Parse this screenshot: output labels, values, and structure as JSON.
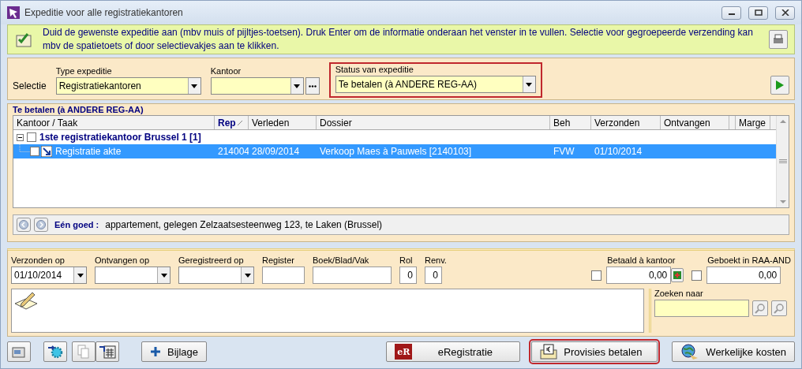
{
  "window": {
    "title": "Expeditie voor alle registratiekantoren"
  },
  "info": {
    "text": "Duid de gewenste expeditie aan (mbv muis of pijltjes-toetsen). Druk Enter om de informatie onderaan het venster in te vullen. Selectie voor gegroepeerde verzending kan mbv de spatietoets of door selectievakjes aan te klikken."
  },
  "selection": {
    "label": "Selectie",
    "fields": [
      {
        "label": "Type expeditie",
        "value": "Registratiekantoren",
        "kind": "dropdown",
        "highlighted": false
      },
      {
        "label": "Kantoor",
        "kind": "browse",
        "highlighted": false
      },
      {
        "label": "Status van expeditie",
        "value": "Te betalen (à ANDERE REG-AA)",
        "kind": "dropdown",
        "highlighted": true
      }
    ]
  },
  "group": {
    "title": "Te betalen (à ANDERE REG-AA)"
  },
  "table": {
    "columns": [
      "Kantoor / Taak",
      "Rep",
      "Verleden",
      "Dossier",
      "Beh",
      "Verzonden",
      "Ontvangen",
      "Marge"
    ],
    "rows": [
      {
        "label": "1ste registratiekantoor Brussel 1 [1]",
        "expanded": true,
        "checked": false,
        "children": [
          {
            "cells": [
              "Registratie akte",
              "214004",
              "28/09/2014",
              "Verkoop Maes à Pauwels [2140103]",
              "FVW",
              "01/10/2014"
            ],
            "checked": false,
            "selected": true
          }
        ]
      }
    ]
  },
  "goed": {
    "label": "Eén goed :",
    "text": "appartement, gelegen Zelzaatsesteenweg 123, te Laken (Brussel)"
  },
  "details": {
    "fields": [
      {
        "label": "Verzonden op",
        "value": "01/10/2014",
        "kind": "dropdown"
      },
      {
        "label": "Ontvangen op",
        "kind": "dropdown"
      },
      {
        "label": "Geregistreerd op",
        "kind": "dropdown"
      },
      {
        "label": "Register",
        "kind": "text"
      },
      {
        "label": "Boek/Blad/Vak",
        "kind": "text"
      },
      {
        "label": "Rol",
        "value": "0",
        "kind": "number"
      },
      {
        "label": "Renv.",
        "value": "0",
        "kind": "number"
      }
    ],
    "amounts": [
      {
        "label": "Betaald à kantoor",
        "value": "0,00",
        "checked": false,
        "kind": "add"
      },
      {
        "label": "Geboekt in RAA-AND",
        "value": "0,00",
        "checked": false,
        "kind": "plain"
      }
    ],
    "search": {
      "label": "Zoeken naar"
    }
  },
  "buttons": [
    {
      "label": "Bijlage",
      "kind": "attach",
      "highlighted": false
    },
    {
      "label": "eRegistratie",
      "kind": "ereg",
      "logo": "eR",
      "highlighted": false
    },
    {
      "label": "Provisies betalen",
      "kind": "euro",
      "highlighted": true
    },
    {
      "label": "Werkelijke kosten",
      "kind": "globe",
      "highlighted": false
    }
  ]
}
